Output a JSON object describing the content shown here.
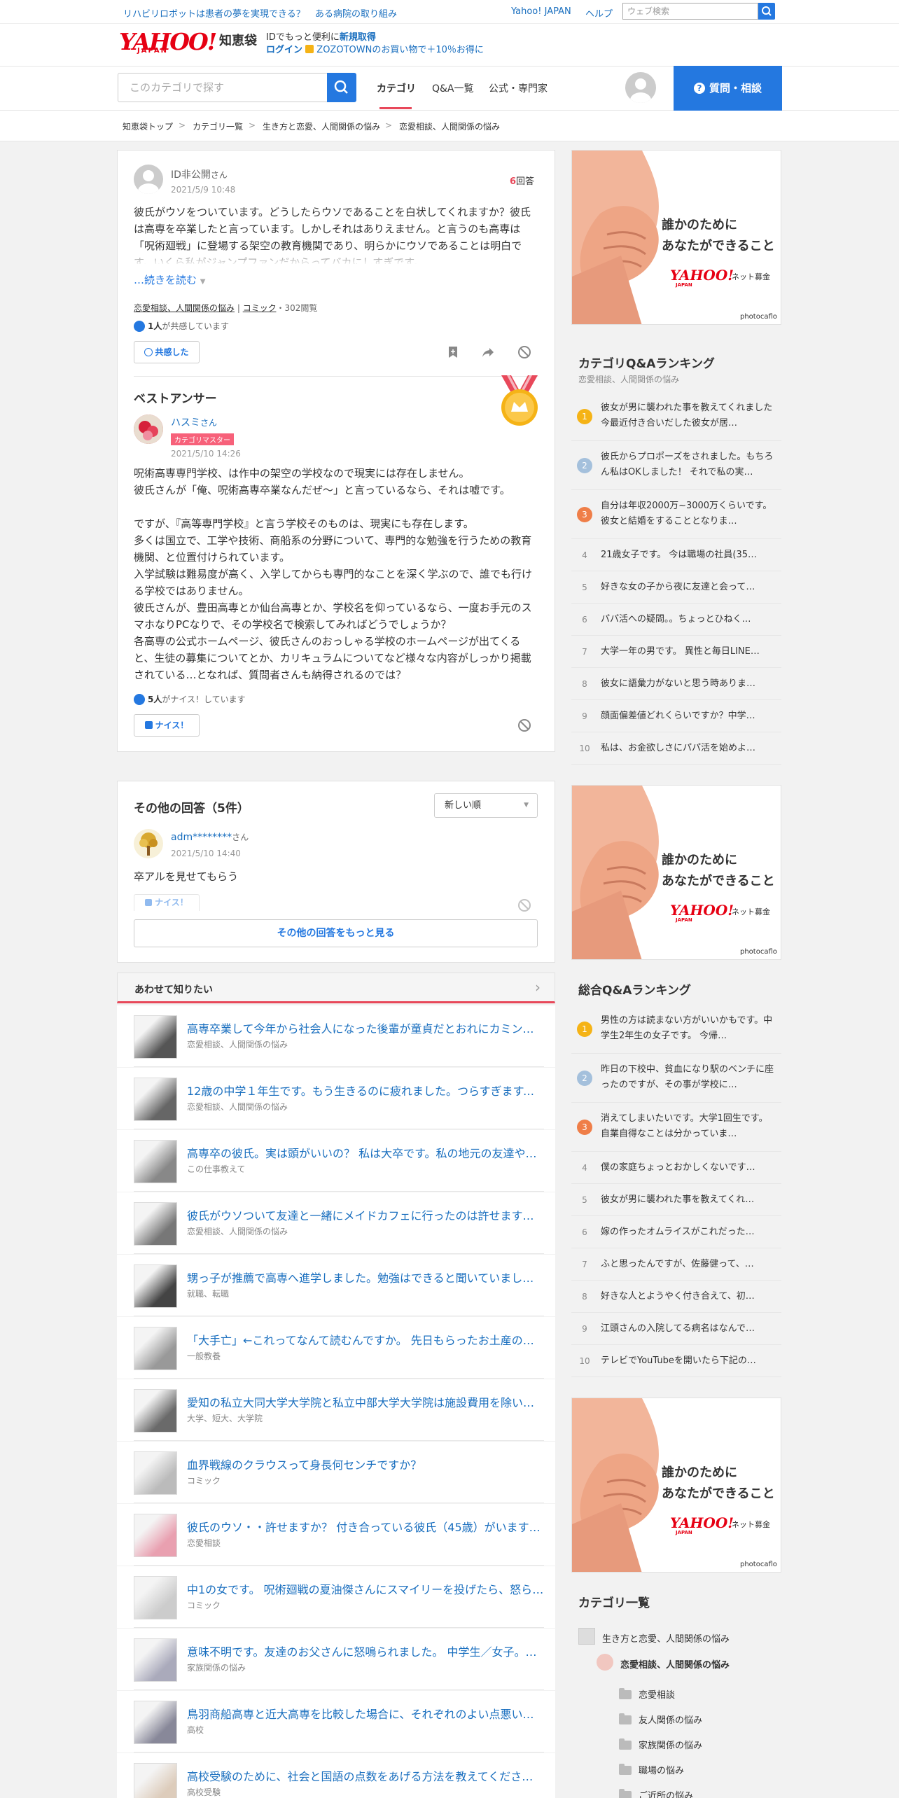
{
  "topbar": {
    "promo1": "リハビリロボットは患者の夢を実現できる？",
    "promo2": "ある病院の取り組み",
    "yahoo_japan": "Yahoo! JAPAN",
    "help": "ヘルプ",
    "search_placeholder": "ウェブ検索"
  },
  "header": {
    "logo": "YAHOO!",
    "logo_sub": "JAPAN",
    "chiebukuro": "知恵袋",
    "id_text": "IDでもっと便利に",
    "new_register": "新規取得",
    "login": "ログイン",
    "zozo": "ZOZOTOWNのお買い物で＋10％お得に"
  },
  "nav": {
    "search_placeholder": "このカテゴリで探す",
    "tabs": [
      {
        "label": "カテゴリ"
      },
      {
        "label": "Q&A一覧"
      },
      {
        "label": "公式・専門家"
      }
    ],
    "ask_button": "質問・相談"
  },
  "breadcrumb": [
    "知恵袋トップ",
    "カテゴリ一覧",
    "生き方と恋愛、人間関係の悩み",
    "恋愛相談、人間関係の悩み"
  ],
  "breadcrumb_sep": ">",
  "question": {
    "user": "ID非公開",
    "user_suffix": "さん",
    "date": "2021/5/9 10:48",
    "answer_count": "6",
    "answer_count_label": "回答",
    "text": "彼氏がウソをついています。どうしたらウソであることを白状してくれますか？彼氏は高専を卒業したと言っています。しかしそれはありえません。と言うのも高専は「呪術廻戦」に登場する架空の教育機関であり、明らかにウソであることは明白です。いくら私がジャンプファンだからってバカにしすぎです。",
    "read_more": "…続きを読む",
    "tag1": "恋愛相談、人間関係の悩み",
    "tag_sep": " | ",
    "tag2": "コミック",
    "views": "・302閲覧",
    "empathy_count": "1人",
    "empathy_label": "が共感しています",
    "empathy_button": "共感した"
  },
  "best_answer": {
    "heading": "ベストアンサー",
    "user": "ハスミ",
    "user_suffix": "さん",
    "badge": "カテゴリマスター",
    "date": "2021/5/10 14:26",
    "text": "呪術高専専門学校、は作中の架空の学校なので現実には存在しません。\n彼氏さんが「俺、呪術高専卒業なんだぜ～」と言っているなら、それは嘘です。\n\nですが、『高等専門学校』と言う学校そのものは、現実にも存在します。\n多くは国立で、工学や技術、商船系の分野について、専門的な勉強を行うための教育機関、と位置付けられています。\n入学試験は難易度が高く、入学してからも専門的なことを深く学ぶので、誰でも行ける学校ではありません。\n彼氏さんが、豊田高専とか仙台高専とか、学校名を仰っているなら、一度お手元のスマホなりPCなりで、その学校名で検索してみればどうでしょうか？\n各高専の公式ホームページ、彼氏さんのおっしゃる学校のホームページが出てくると、生徒の募集についてとか、カリキュラムについてなど様々な内容がしっかり掲載されている…となれば、質問者さんも納得されるのでは？",
    "nice_count": "5人",
    "nice_label": "がナイス！しています",
    "nice_button": "ナイス！"
  },
  "other_answers": {
    "heading": "その他の回答（5件）",
    "sort": "新しい順",
    "user": "adm********",
    "user_suffix": "さん",
    "date": "2021/5/10 14:40",
    "text": "卒アルを見せてもらう",
    "nice_button": "ナイス！",
    "more_button": "その他の回答をもっと見る"
  },
  "related": {
    "heading": "あわせて知りたい",
    "items": [
      {
        "title": "高専卒業して今年から社会人になった後輩が童貞だとおれにカミングアウトしてきました…",
        "cat": "恋愛相談、人間関係の悩み"
      },
      {
        "title": "12歳の中学１年生です。もう生きるのに疲れました。つらすぎます。最近…",
        "cat": "恋愛相談、人間関係の悩み"
      },
      {
        "title": "高専卒の彼氏。実は頭がいいの？ 私は大卒です。私の地元の友達や…",
        "cat": "この仕事教えて"
      },
      {
        "title": "彼氏がウソついて友達と一緒にメイドカフェに行ったのは許せますか…",
        "cat": "恋愛相談、人間関係の悩み"
      },
      {
        "title": "甥っ子が推薦で高専へ進学しました。勉強はできると聞いていましたが…",
        "cat": "就職、転職"
      },
      {
        "title": "「大手亡」←これってなんて読むんですか。 先日もらったお土産の…",
        "cat": "一般教養"
      },
      {
        "title": "愛知の私立大同大学大学院と私立中部大学大学院は施設費用を除いた…",
        "cat": "大学、短大、大学院"
      },
      {
        "title": "血界戦線のクラウスって身長何センチですか？",
        "cat": "コミック"
      },
      {
        "title": "彼氏のウソ・・許せますか？ 付き合っている彼氏（45歳）がいます…",
        "cat": "恋愛相談"
      },
      {
        "title": "中1の女です。 呪術廻戦の夏油傑さんにスマイリーを投げたら、怒られ…",
        "cat": "コミック"
      },
      {
        "title": "意味不明です。友達のお父さんに怒鳴られました。 中学生／女子。…",
        "cat": "家族関係の悩み"
      },
      {
        "title": "鳥羽商船高専と近大高専を比較した場合に、それぞれのよい点悪い点を…",
        "cat": "高校"
      },
      {
        "title": "高校受験のために、社会と国語の点数をあげる方法を教えてください…",
        "cat": "高校受験"
      }
    ]
  },
  "ad": {
    "line1": "誰かのために",
    "line2": "あなたができること",
    "brand": "YAHOO!",
    "brand_sub": "JAPAN",
    "brand_suffix": "ネット募金",
    "credit": "photocaflo"
  },
  "category_ranking": {
    "title": "カテゴリQ&Aランキング",
    "subtitle": "恋愛相談、人間関係の悩み",
    "items": [
      {
        "num": "1",
        "text": "彼女が男に襲われた事を教えてくれました今最近付き合いだした彼女が居…"
      },
      {
        "num": "2",
        "text": "彼氏からプロポーズをされました。もちろん私はOKしました！ それで私の実…"
      },
      {
        "num": "3",
        "text": "自分は年収2000万~3000万くらいです。彼女と結婚をすることとなりま…"
      },
      {
        "num": "4",
        "text": "21歳女子です。 今は職場の社員(35…"
      },
      {
        "num": "5",
        "text": "好きな女の子から夜に友達と会って…"
      },
      {
        "num": "6",
        "text": "パパ活への疑問。。ちょっとひねく…"
      },
      {
        "num": "7",
        "text": "大学一年の男です。 異性と毎日LINE…"
      },
      {
        "num": "8",
        "text": "彼女に語彙力がないと思う時ありま…"
      },
      {
        "num": "9",
        "text": "顔面偏差値どれくらいですか？中学…"
      },
      {
        "num": "10",
        "text": "私は、お金欲しさにパパ活を始めよ…"
      }
    ]
  },
  "overall_ranking": {
    "title": "総合Q&Aランキング",
    "items": [
      {
        "num": "1",
        "text": "男性の方は読まない方がいいかもです。中学生2年生の女子です。 今帰…"
      },
      {
        "num": "2",
        "text": "昨日の下校中、貧血になり駅のベンチに座ったのですが、その事が学校に…"
      },
      {
        "num": "3",
        "text": "消えてしまいたいです。大学1回生です。 自業自得なことは分かっていま…"
      },
      {
        "num": "4",
        "text": "僕の家庭ちょっとおかしくないです…"
      },
      {
        "num": "5",
        "text": "彼女が男に襲われた事を教えてくれ…"
      },
      {
        "num": "6",
        "text": "嫁の作ったオムライスがこれだった…"
      },
      {
        "num": "7",
        "text": "ふと思ったんですが、佐藤健って、…"
      },
      {
        "num": "8",
        "text": "好きな人とようやく付き合えて、初…"
      },
      {
        "num": "9",
        "text": "江頭さんの入院してる病名はなんで…"
      },
      {
        "num": "10",
        "text": "テレビでYouTubeを開いたら下記の…"
      }
    ]
  },
  "category_list": {
    "title": "カテゴリ一覧",
    "parent": "生き方と恋愛、人間関係の悩み",
    "current": "恋愛相談、人間関係の悩み",
    "children": [
      "恋愛相談",
      "友人関係の悩み",
      "家族関係の悩み",
      "職場の悩み",
      "ご近所の悩み"
    ]
  },
  "colors": {
    "accent_blue": "#2478e0",
    "link_blue": "#1a6fbf",
    "red": "#e8485a",
    "rank1": "#f5b316",
    "rank2": "#a4c0dc",
    "rank3": "#ef7e48"
  }
}
